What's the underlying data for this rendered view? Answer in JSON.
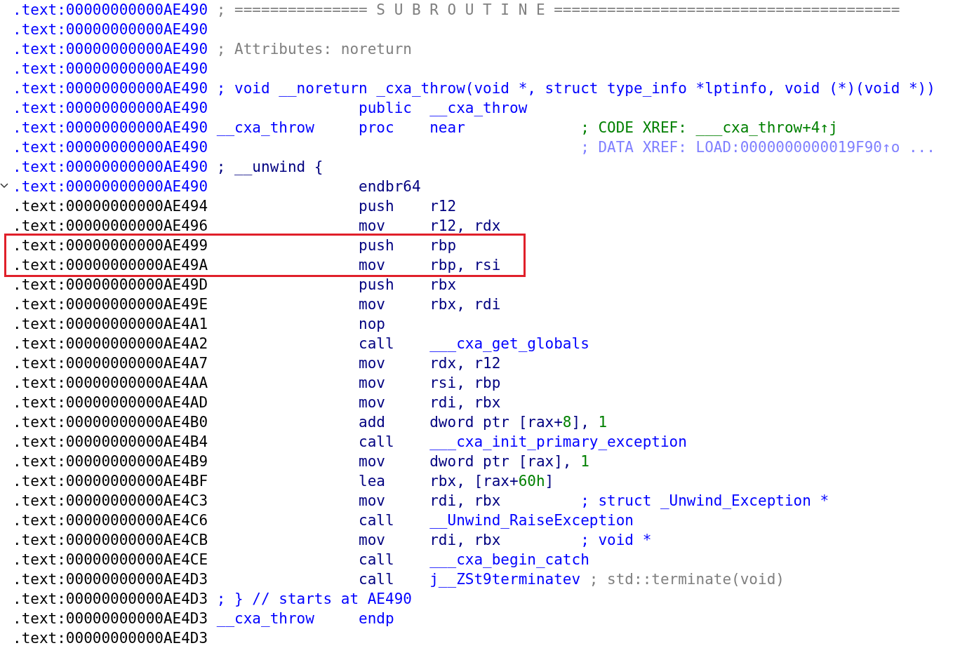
{
  "listing": [
    {
      "address": {
        "text": ".text:00000000000AE490",
        "color": "#0000ff"
      },
      "line_comment": {
        "text": "; =============== S U B R O U T I N E =======================================",
        "color": "#808080"
      }
    },
    {
      "address": {
        "text": ".text:00000000000AE490",
        "color": "#0000ff"
      }
    },
    {
      "address": {
        "text": ".text:00000000000AE490",
        "color": "#0000ff"
      },
      "line_comment": {
        "text": "; Attributes: noreturn",
        "color": "#808080"
      }
    },
    {
      "address": {
        "text": ".text:00000000000AE490",
        "color": "#0000ff"
      }
    },
    {
      "address": {
        "text": ".text:00000000000AE490",
        "color": "#0000ff"
      },
      "line_comment": {
        "text": "; void __noreturn _cxa_throw(void *, struct type_info *lptinfo, void (*)(void *))",
        "color": "#0000ff"
      }
    },
    {
      "address": {
        "text": ".text:00000000000AE490",
        "color": "#0000ff"
      },
      "mnemonic": {
        "text": "public",
        "color": "#0000ff"
      },
      "operands": [
        {
          "text": "__cxa_throw",
          "color": "#0000ff"
        }
      ]
    },
    {
      "address": {
        "text": ".text:00000000000AE490",
        "color": "#0000ff"
      },
      "label": "__cxa_throw",
      "mnemonic": {
        "text": "proc",
        "color": "#0000ff"
      },
      "operands": [
        {
          "text": "near",
          "color": "#0000ff"
        }
      ],
      "comment": {
        "text": "; CODE XREF: ___cxa_throw+4↑j",
        "color": "#008000"
      }
    },
    {
      "address": {
        "text": ".text:00000000000AE490",
        "color": "#0000ff"
      },
      "comment": {
        "text": "; DATA XREF: LOAD:0000000000019F90↑o ...",
        "color": "#8080ff"
      }
    },
    {
      "address": {
        "text": ".text:00000000000AE490",
        "color": "#0000ff"
      },
      "line_comment": {
        "text": "; __unwind {",
        "color": "#000080"
      }
    },
    {
      "address": {
        "text": ".text:00000000000AE490",
        "color": "#0000ff"
      },
      "fold_marker": true,
      "mnemonic": {
        "text": "endbr64",
        "color": "#000080"
      }
    },
    {
      "address": {
        "text": ".text:00000000000AE494",
        "color": "#000000"
      },
      "mnemonic": {
        "text": "push",
        "color": "#000080"
      },
      "operands": [
        {
          "text": "r12",
          "color": "#000080"
        }
      ]
    },
    {
      "address": {
        "text": ".text:00000000000AE496",
        "color": "#000000"
      },
      "mnemonic": {
        "text": "mov",
        "color": "#000080"
      },
      "operands": [
        {
          "text": "r12, rdx",
          "color": "#000080"
        }
      ]
    },
    {
      "address": {
        "text": ".text:00000000000AE499",
        "color": "#000000"
      },
      "highlighted": true,
      "mnemonic": {
        "text": "push",
        "color": "#000080"
      },
      "operands": [
        {
          "text": "rbp",
          "color": "#000080"
        }
      ]
    },
    {
      "address": {
        "text": ".text:00000000000AE49A",
        "color": "#000000"
      },
      "highlighted": true,
      "mnemonic": {
        "text": "mov",
        "color": "#000080"
      },
      "operands": [
        {
          "text": "rbp, rsi",
          "color": "#000080"
        }
      ]
    },
    {
      "address": {
        "text": ".text:00000000000AE49D",
        "color": "#000000"
      },
      "mnemonic": {
        "text": "push",
        "color": "#000080"
      },
      "operands": [
        {
          "text": "rbx",
          "color": "#000080"
        }
      ]
    },
    {
      "address": {
        "text": ".text:00000000000AE49E",
        "color": "#000000"
      },
      "mnemonic": {
        "text": "mov",
        "color": "#000080"
      },
      "operands": [
        {
          "text": "rbx, rdi",
          "color": "#000080"
        }
      ]
    },
    {
      "address": {
        "text": ".text:00000000000AE4A1",
        "color": "#000000"
      },
      "mnemonic": {
        "text": "nop",
        "color": "#000080"
      }
    },
    {
      "address": {
        "text": ".text:00000000000AE4A2",
        "color": "#000000"
      },
      "mnemonic": {
        "text": "call",
        "color": "#000080"
      },
      "operands": [
        {
          "text": "___cxa_get_globals",
          "color": "#0000ff"
        }
      ]
    },
    {
      "address": {
        "text": ".text:00000000000AE4A7",
        "color": "#000000"
      },
      "mnemonic": {
        "text": "mov",
        "color": "#000080"
      },
      "operands": [
        {
          "text": "rdx, r12",
          "color": "#000080"
        }
      ]
    },
    {
      "address": {
        "text": ".text:00000000000AE4AA",
        "color": "#000000"
      },
      "mnemonic": {
        "text": "mov",
        "color": "#000080"
      },
      "operands": [
        {
          "text": "rsi, rbp",
          "color": "#000080"
        }
      ]
    },
    {
      "address": {
        "text": ".text:00000000000AE4AD",
        "color": "#000000"
      },
      "mnemonic": {
        "text": "mov",
        "color": "#000080"
      },
      "operands": [
        {
          "text": "rdi, rbx",
          "color": "#000080"
        }
      ]
    },
    {
      "address": {
        "text": ".text:00000000000AE4B0",
        "color": "#000000"
      },
      "mnemonic": {
        "text": "add",
        "color": "#000080"
      },
      "operands": [
        {
          "text": "dword ptr [rax+",
          "color": "#000080"
        },
        {
          "text": "8",
          "color": "#008000"
        },
        {
          "text": "], ",
          "color": "#000080"
        },
        {
          "text": "1",
          "color": "#008000"
        }
      ]
    },
    {
      "address": {
        "text": ".text:00000000000AE4B4",
        "color": "#000000"
      },
      "mnemonic": {
        "text": "call",
        "color": "#000080"
      },
      "operands": [
        {
          "text": "___cxa_init_primary_exception",
          "color": "#0000ff"
        }
      ]
    },
    {
      "address": {
        "text": ".text:00000000000AE4B9",
        "color": "#000000"
      },
      "mnemonic": {
        "text": "mov",
        "color": "#000080"
      },
      "operands": [
        {
          "text": "dword ptr [rax], ",
          "color": "#000080"
        },
        {
          "text": "1",
          "color": "#008000"
        }
      ]
    },
    {
      "address": {
        "text": ".text:00000000000AE4BF",
        "color": "#000000"
      },
      "mnemonic": {
        "text": "lea",
        "color": "#000080"
      },
      "operands": [
        {
          "text": "rbx, [rax+",
          "color": "#000080"
        },
        {
          "text": "60h",
          "color": "#008000"
        },
        {
          "text": "]",
          "color": "#000080"
        }
      ]
    },
    {
      "address": {
        "text": ".text:00000000000AE4C3",
        "color": "#000000"
      },
      "mnemonic": {
        "text": "mov",
        "color": "#000080"
      },
      "operands": [
        {
          "text": "rdi, rbx",
          "color": "#000080"
        }
      ],
      "comment": {
        "text": "; struct _Unwind_Exception *",
        "color": "#0000ff"
      }
    },
    {
      "address": {
        "text": ".text:00000000000AE4C6",
        "color": "#000000"
      },
      "mnemonic": {
        "text": "call",
        "color": "#000080"
      },
      "operands": [
        {
          "text": "__Unwind_RaiseException",
          "color": "#0000ff"
        }
      ]
    },
    {
      "address": {
        "text": ".text:00000000000AE4CB",
        "color": "#000000"
      },
      "mnemonic": {
        "text": "mov",
        "color": "#000080"
      },
      "operands": [
        {
          "text": "rdi, rbx",
          "color": "#000080"
        }
      ],
      "comment": {
        "text": "; void *",
        "color": "#0000ff"
      }
    },
    {
      "address": {
        "text": ".text:00000000000AE4CE",
        "color": "#000000"
      },
      "mnemonic": {
        "text": "call",
        "color": "#000080"
      },
      "operands": [
        {
          "text": "___cxa_begin_catch",
          "color": "#0000ff"
        }
      ]
    },
    {
      "address": {
        "text": ".text:00000000000AE4D3",
        "color": "#000000"
      },
      "mnemonic": {
        "text": "call",
        "color": "#000080"
      },
      "operands": [
        {
          "text": "j__ZSt9terminatev",
          "color": "#0000ff"
        }
      ],
      "comment": {
        "text": "; std::terminate(void)",
        "color": "#808080"
      }
    },
    {
      "address": {
        "text": ".text:00000000000AE4D3",
        "color": "#000000"
      },
      "line_comment": {
        "text": "; } // starts at AE490",
        "color": "#0000ff"
      }
    },
    {
      "address": {
        "text": ".text:00000000000AE4D3",
        "color": "#000000"
      },
      "label": "__cxa_throw",
      "mnemonic": {
        "text": "endp",
        "color": "#0000ff"
      }
    },
    {
      "address": {
        "text": ".text:00000000000AE4D3",
        "color": "#000000"
      }
    }
  ]
}
